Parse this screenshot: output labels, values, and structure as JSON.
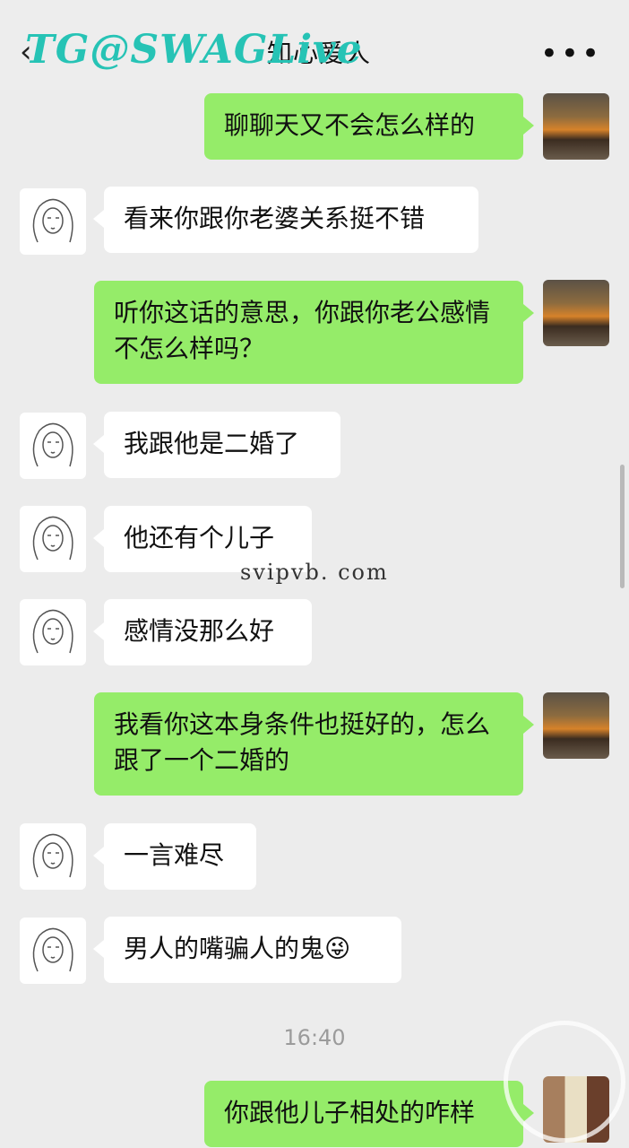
{
  "header": {
    "back_icon": "chevron-left-icon",
    "title": "知心爱人",
    "more_icon": "more-dots-icon",
    "watermark": "TG@SWAGLive"
  },
  "messages": [
    {
      "side": "right",
      "text": "聊聊天又不会怎么样的"
    },
    {
      "side": "left",
      "text": "看来你跟你老婆关系挺不错"
    },
    {
      "side": "right",
      "text": "听你这话的意思，你跟你老公感情不怎么样吗？"
    },
    {
      "side": "left",
      "text": "我跟他是二婚了"
    },
    {
      "side": "left",
      "text": "他还有个儿子"
    },
    {
      "side": "left",
      "text": "感情没那么好"
    },
    {
      "side": "right",
      "text": "我看你这本身条件也挺好的，怎么跟了一个二婚的"
    },
    {
      "side": "left",
      "text": "一言难尽"
    },
    {
      "side": "left",
      "text": "男人的嘴骗人的鬼😜"
    },
    {
      "side": "right",
      "text": "你跟他儿子相处的咋样"
    }
  ],
  "timestamp": "16:40",
  "overlay_text": "svipvb. com",
  "colors": {
    "background": "#ececec",
    "bubble_right": "#95ec69",
    "bubble_left": "#ffffff",
    "watermark": "#26c3b5"
  }
}
